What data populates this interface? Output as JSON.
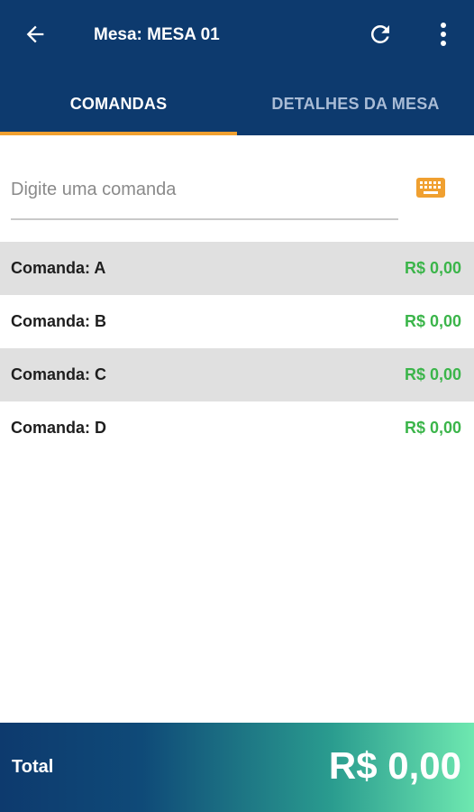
{
  "header": {
    "title": "Mesa: MESA 01",
    "back_icon": "arrow-left-icon",
    "refresh_icon": "refresh-icon",
    "menu_icon": "more-vertical-icon",
    "background": "#0d3a6e"
  },
  "tabs": [
    {
      "label": "COMANDAS",
      "active": true
    },
    {
      "label": "DETALHES DA MESA",
      "active": false
    }
  ],
  "tab_indicator_color": "#f0a030",
  "search": {
    "placeholder": "Digite uma comanda",
    "value": "",
    "keyboard_icon": "keyboard-icon"
  },
  "comandas": [
    {
      "label": "Comanda: A",
      "value": "R$ 0,00"
    },
    {
      "label": "Comanda: B",
      "value": "R$ 0,00"
    },
    {
      "label": "Comanda: C",
      "value": "R$ 0,00"
    },
    {
      "label": "Comanda: D",
      "value": "R$ 0,00"
    }
  ],
  "value_color": "#3bb54a",
  "footer": {
    "label": "Total",
    "value": "R$ 0,00"
  }
}
